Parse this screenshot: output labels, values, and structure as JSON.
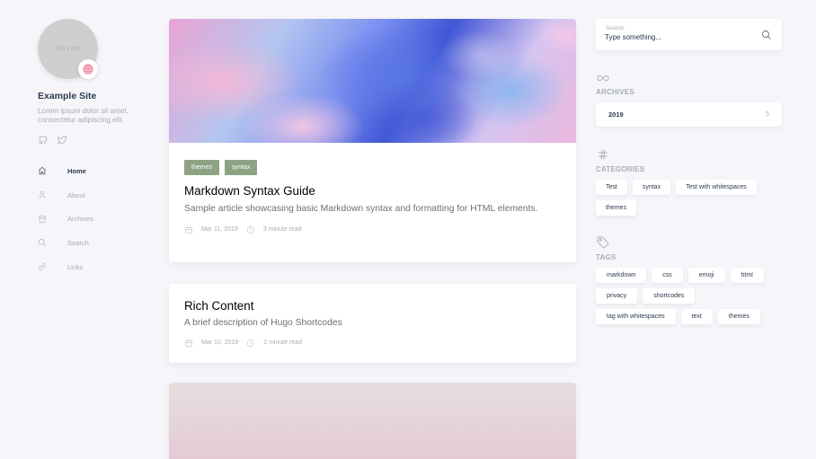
{
  "site": {
    "avatar_text": "150 x 150",
    "emoji": "🍥",
    "title": "Example Site",
    "description": "Lorem ipsum dolor sit amet, consectetur adipiscing elit."
  },
  "social": [
    "github-icon",
    "twitter-icon"
  ],
  "menu": {
    "home": "Home",
    "about": "About",
    "archives": "Archives",
    "search": "Search",
    "links": "Links"
  },
  "articles": [
    {
      "tags": [
        "themes",
        "syntax"
      ],
      "title": "Markdown Syntax Guide",
      "description": "Sample article showcasing basic Markdown syntax and formatting for HTML elements.",
      "date": "Mar 11, 2019",
      "read_time": "3 minute read"
    },
    {
      "title": "Rich Content",
      "description": "A brief description of Hugo Shortcodes",
      "date": "Mar 10, 2019",
      "read_time": "2 minute read"
    }
  ],
  "search": {
    "label": "Search",
    "placeholder": "Type something..."
  },
  "archives": {
    "title": "ARCHIVES",
    "year": "2019",
    "count": "5"
  },
  "categories": {
    "title": "CATEGORIES",
    "items": [
      "Test",
      "syntax",
      "Test with whitespaces",
      "themes"
    ]
  },
  "tags": {
    "title": "TAGS",
    "items": [
      "markdown",
      "css",
      "emoji",
      "html",
      "privacy",
      "shortcodes",
      "tag with whitespaces",
      "text",
      "themes"
    ]
  },
  "colors": {
    "background": "#f5f5fa",
    "tag_bg": "#8da283",
    "muted": "#a7adb8",
    "heading": "#2d3a4d"
  }
}
